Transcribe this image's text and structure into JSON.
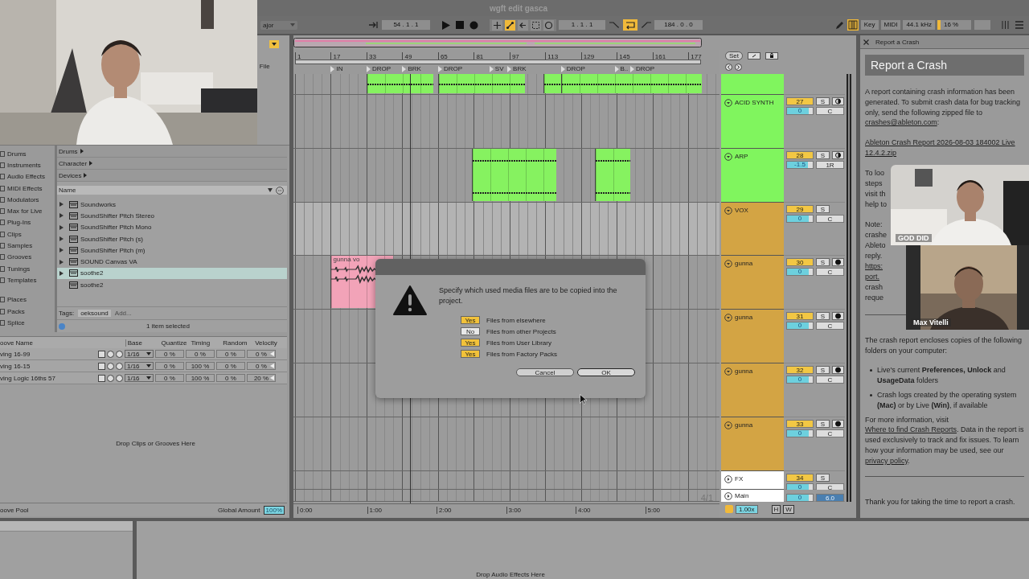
{
  "window": {
    "title": "wgft edit gasca"
  },
  "control_bar": {
    "scale": "ajor",
    "position": "54 . 1 . 1",
    "follow_on": true,
    "loop_start": "1 . 1 . 1",
    "loop_on": true,
    "loop_length": "184 . 0 . 0",
    "keyboard_on": true,
    "key_map": "Key",
    "midi_map": "MIDI",
    "sample_rate": "44.1 kHz",
    "cpu": "16 %"
  },
  "left_strip": {
    "file_label": "File"
  },
  "browser": {
    "categories": [
      "Drums",
      "Instruments",
      "Audio Effects",
      "MIDI Effects",
      "Modulators",
      "Max for Live",
      "Plug-Ins",
      "Clips",
      "Samples",
      "Grooves",
      "Tunings",
      "Templates"
    ],
    "places": [
      "Places",
      "Packs",
      "Splice"
    ],
    "filters": [
      "Drums",
      "Character",
      "Devices"
    ],
    "column": "Name",
    "items": [
      {
        "name": "Soundworks",
        "expandable": true,
        "selected": false
      },
      {
        "name": "SoundShifter Pitch Stereo",
        "expandable": true,
        "selected": false
      },
      {
        "name": "SoundShifter Pitch Mono",
        "expandable": true,
        "selected": false
      },
      {
        "name": "SoundShifter Pitch (s)",
        "expandable": true,
        "selected": false
      },
      {
        "name": "SoundShifter Pitch (m)",
        "expandable": true,
        "selected": false
      },
      {
        "name": "SOUND Canvas VA",
        "expandable": true,
        "selected": false
      },
      {
        "name": "soothe2",
        "expandable": true,
        "selected": true
      },
      {
        "name": "soothe2",
        "expandable": false,
        "selected": false
      }
    ],
    "tags_label": "Tags:",
    "tag": "oeksound",
    "tag_placeholder": "Add...",
    "status": "1 item selected"
  },
  "groove_pool": {
    "columns": [
      "oove Name",
      "Base",
      "Quantize",
      "Timing",
      "Random",
      "Velocity"
    ],
    "rows": [
      {
        "name": "ving 16-99",
        "base": "1/16",
        "quantize": "0 %",
        "timing": "0 %",
        "random": "0 %",
        "velocity": "0 %"
      },
      {
        "name": "ving 16-15",
        "base": "1/16",
        "quantize": "0 %",
        "timing": "100 %",
        "random": "0 %",
        "velocity": "0 %"
      },
      {
        "name": "ving Logic 16ths 57",
        "base": "1/16",
        "quantize": "0 %",
        "timing": "100 %",
        "random": "0 %",
        "velocity": "20 %"
      }
    ],
    "empty_hint": "Drop Clips or Grooves Here",
    "footer": "oove Pool",
    "global_amount_label": "Global Amount",
    "global_amount": "100%"
  },
  "arrangement": {
    "ruler": [
      "1",
      "17",
      "33",
      "49",
      "65",
      "81",
      "97",
      "113",
      "129",
      "145",
      "161",
      "177"
    ],
    "locators": [
      "IN",
      "DROP",
      "BRK",
      "DROP",
      "SV",
      "BRK",
      "DROP",
      "B..",
      "DROP"
    ],
    "time_ruler": [
      "0:00",
      "1:00",
      "2:00",
      "3:00",
      "4:00",
      "5:00"
    ],
    "time_signature": "4/1"
  },
  "tracks": [
    {
      "kind": "tail",
      "color": "#80f55e",
      "clips": [
        {
          "color": "#86f260"
        },
        {
          "color": "#86f260"
        },
        {
          "color": "#86f260"
        },
        {
          "color": "#86f260"
        }
      ]
    },
    {
      "kind": "midi",
      "name": "ACID SYNTH",
      "color": "#80f55e",
      "number": "27",
      "solo": "S",
      "monitor_on": true,
      "volume": {
        "value": "0",
        "level": 0.85
      },
      "pan": "C"
    },
    {
      "kind": "midi",
      "name": "ARP",
      "color": "#80f55e",
      "number": "28",
      "solo": "S",
      "monitor_on": true,
      "volume": {
        "value": "-1.5",
        "level": 0.8
      },
      "pan": "1R",
      "clips": [
        {
          "color": "#86f260"
        },
        {
          "color": "#86f260"
        }
      ]
    },
    {
      "kind": "group",
      "name": "VOX",
      "color": "#d3a444",
      "number": "29",
      "solo": "S",
      "volume": {
        "value": "0",
        "level": 0.85
      },
      "pan": "C"
    },
    {
      "kind": "audio",
      "name": "gunna",
      "color": "#d3a444",
      "number": "30",
      "solo": "S",
      "record_armed": true,
      "volume": {
        "value": "0",
        "level": 0.85
      },
      "pan": "C",
      "clips": [
        {
          "color": "#f2a3b8",
          "label": "gunna vo"
        }
      ]
    },
    {
      "kind": "audio",
      "name": "gunna",
      "color": "#d3a444",
      "number": "31",
      "solo": "S",
      "record_armed": true,
      "volume": {
        "value": "0",
        "level": 0.85
      },
      "pan": "C"
    },
    {
      "kind": "audio",
      "name": "gunna",
      "color": "#d3a444",
      "number": "32",
      "solo": "S",
      "record_armed": true,
      "volume": {
        "value": "0",
        "level": 0.85
      },
      "pan": "C"
    },
    {
      "kind": "audio",
      "name": "gunna",
      "color": "#d3a444",
      "number": "33",
      "solo": "S",
      "record_armed": true,
      "volume": {
        "value": "0",
        "level": 0.85
      },
      "pan": "C"
    },
    {
      "kind": "return",
      "name": "FX",
      "color": "#ffffff",
      "number": "34",
      "solo": "S",
      "volume": {
        "value": "0",
        "level": 0.85
      },
      "pan": "C"
    },
    {
      "kind": "main",
      "name": "Main",
      "color": "#ffffff",
      "volume": {
        "value": "0",
        "level": 0.85
      },
      "pan": "6.0"
    }
  ],
  "mixer_footer": {
    "zoom": "1.00x",
    "h": "H",
    "w": "W"
  },
  "mixer_header": {
    "set": "Set"
  },
  "crash_panel": {
    "tab": "Report a Crash",
    "title": "Report a Crash",
    "intro": "A report containing crash information has been generated. To submit crash data for bug tracking only, send the following zipped file to",
    "email": "crashes@ableton.com",
    "intro_end": ":",
    "file_link": "Ableton Crash Report 2026-08-03 184002 Live 12.4.2.zip",
    "fragments": [
      {
        "text": "To loo",
        "link": false
      },
      {
        "text": "steps",
        "link": false
      },
      {
        "text": "visit th",
        "link": false
      },
      {
        "text": "help to",
        "link": false
      },
      {
        "text": "Note:",
        "link": false
      },
      {
        "text": "crashe",
        "link": false
      },
      {
        "text": "Ableto",
        "link": false
      },
      {
        "text": "reply.",
        "link": false
      },
      {
        "text": "https:",
        "link": true
      },
      {
        "text": "port.",
        "link": true
      },
      {
        "text": "crash",
        "link": false
      },
      {
        "text": "reque",
        "link": false
      }
    ],
    "encloses": "The crash report encloses copies of the following folders on your computer:",
    "bullets": [
      "Live's current **Preferences, Unlock** and **UsageData** folders",
      "Crash logs created by the operating system **(Mac)** or by Live **(Win)**, if available"
    ],
    "more_before": "For more information, visit",
    "more_link": "Where to find Crash Reports",
    "more_after": ". Data in the report is used exclusively to track and fix issues. To learn how your information may be used, see our",
    "privacy_link": "privacy policy",
    "privacy_after": ".",
    "thanks": "Thank you for taking the time to report a crash."
  },
  "video_call": [
    {
      "name": "GOD DID"
    },
    {
      "name": "Max Vitelli"
    }
  ],
  "dialog": {
    "message": "Specify which used media files are to be copied into the project.",
    "options": [
      {
        "value": "Yes",
        "on": true,
        "label": "Files from elsewhere"
      },
      {
        "value": "No",
        "on": false,
        "label": "Files from other Projects"
      },
      {
        "value": "Yes",
        "on": true,
        "label": "Files from User Library"
      },
      {
        "value": "Yes",
        "on": true,
        "label": "Files from Factory Packs"
      }
    ],
    "buttons": [
      {
        "label": "Cancel",
        "default": false
      },
      {
        "label": "OK",
        "default": true
      }
    ]
  },
  "device_view": {
    "hint": "Drop Audio Effects Here"
  }
}
